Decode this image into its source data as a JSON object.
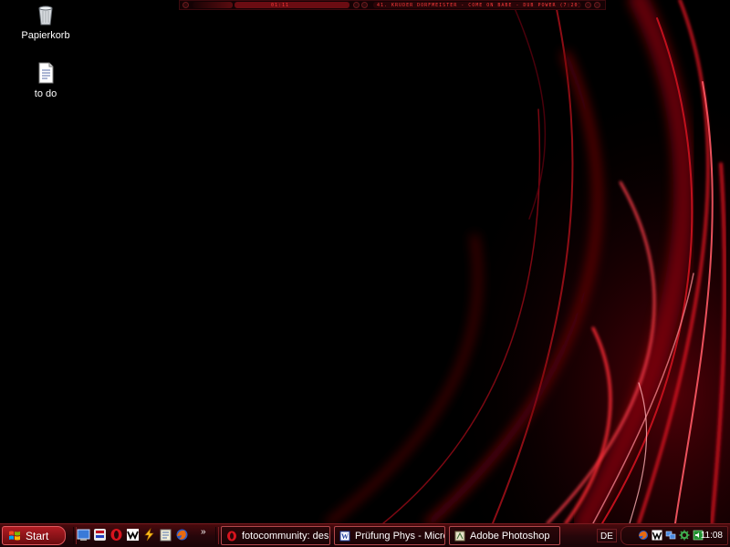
{
  "desktop": {
    "icons": [
      {
        "label": "Papierkorb",
        "icon": "recycle-bin-icon"
      },
      {
        "label": "to do",
        "icon": "text-document-icon"
      }
    ]
  },
  "media_bar": {
    "time": "01:11",
    "ticker": "41. KRUDER DORFMEISTER - COME ON BABE - DUB POWER (7:20)"
  },
  "taskbar": {
    "start_label": "Start",
    "quick_launch": [
      "show-desktop-icon",
      "media-player-icon",
      "opera-icon",
      "winamp-icon",
      "flashget-icon",
      "notepad-icon",
      "firefox-icon"
    ],
    "more_label": "»",
    "tasks": [
      {
        "label": "fotocommunity: deskt...",
        "icon": "opera-icon"
      },
      {
        "label": "Prüfung Phys - Micros...",
        "icon": "word-icon"
      },
      {
        "label": "Adobe Photoshop",
        "icon": "photoshop-icon"
      }
    ],
    "language": "DE",
    "tray_icons": [
      "firefox-icon",
      "winamp-icon",
      "network-icon",
      "gear-icon",
      "volume-icon"
    ],
    "clock": "11:08"
  },
  "colors": {
    "accent": "#d8141e",
    "taskbar_dark": "#1a0407",
    "border": "#b3474c"
  }
}
